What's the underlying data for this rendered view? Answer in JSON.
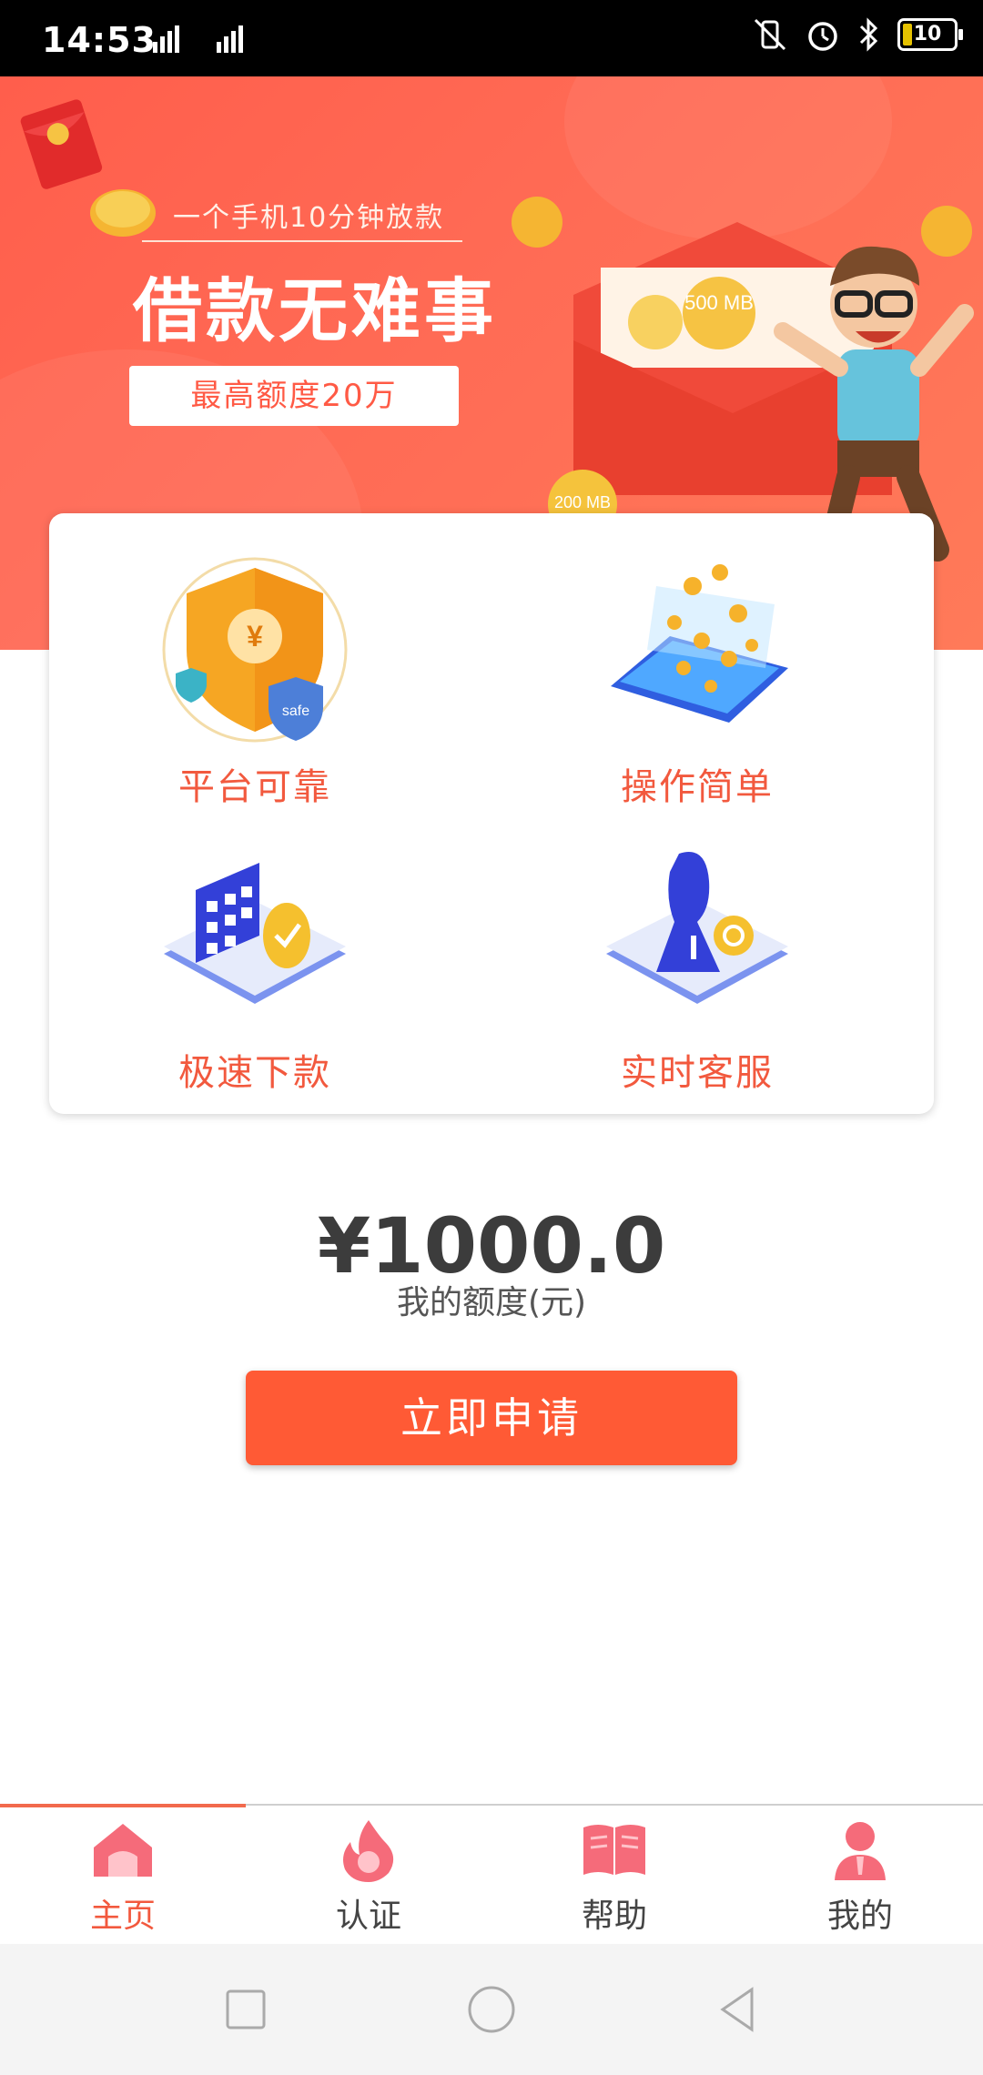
{
  "status_bar": {
    "time": "14:53",
    "network": "2G 4G HD",
    "battery": "10"
  },
  "banner": {
    "subtitle": "一个手机10分钟放款",
    "title": "借款无难事",
    "badge": "最高额度20万",
    "coin_label_1": "500 MB",
    "coin_label_2": "200 MB"
  },
  "features": [
    {
      "label": "平台可靠",
      "icon": "shield-yen-icon"
    },
    {
      "label": "操作简单",
      "icon": "phone-coins-icon"
    },
    {
      "label": "极速下款",
      "icon": "calendar-clock-icon"
    },
    {
      "label": "实时客服",
      "icon": "customer-service-icon"
    }
  ],
  "quota": {
    "amount": "¥1000.0",
    "label": "我的额度(元)"
  },
  "apply_button": "立即申请",
  "tabs": [
    {
      "label": "主页",
      "icon": "home-icon",
      "active": true
    },
    {
      "label": "认证",
      "icon": "fire-icon",
      "active": false
    },
    {
      "label": "帮助",
      "icon": "book-icon",
      "active": false
    },
    {
      "label": "我的",
      "icon": "user-icon",
      "active": false
    }
  ],
  "system_nav": [
    "recent-apps-icon",
    "home-circle-icon",
    "back-icon"
  ],
  "colors": {
    "accent": "#ff5a35",
    "banner": "#ff6b55",
    "feature_text": "#f2593e",
    "tab_icon": "#f56b7a"
  }
}
